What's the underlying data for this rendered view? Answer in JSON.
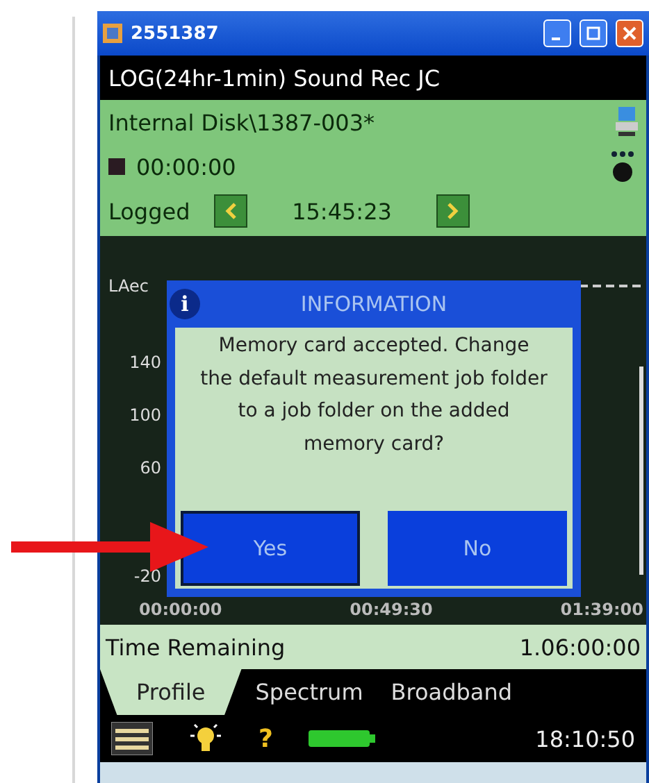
{
  "window": {
    "title": "2551387"
  },
  "subtitle": "LOG(24hr-1min) Sound Rec JC",
  "status": {
    "path": "Internal Disk\\1387-003*",
    "elapsed": "00:00:00",
    "state": "Logged",
    "time": "15:45:23"
  },
  "chart": {
    "parameter": "LAec",
    "y_ticks": [
      "140",
      "100",
      "60",
      "-20"
    ],
    "x_ticks": [
      "00:00:00",
      "00:49:30",
      "01:39:00"
    ]
  },
  "remaining": {
    "label": "Time Remaining",
    "value": "1.06:00:00"
  },
  "tabs": [
    {
      "label": "Profile",
      "selected": true
    },
    {
      "label": "Spectrum",
      "selected": false
    },
    {
      "label": "Broadband",
      "selected": false
    }
  ],
  "toolbar": {
    "help": "?",
    "clock": "18:10:50"
  },
  "dialog": {
    "title": "INFORMATION",
    "icon": "i",
    "message": "Memory card accepted. Change the default measurement job folder to a job folder on the added memory card?",
    "buttons": [
      {
        "label": "Yes",
        "selected": true
      },
      {
        "label": "No",
        "selected": false
      }
    ]
  }
}
